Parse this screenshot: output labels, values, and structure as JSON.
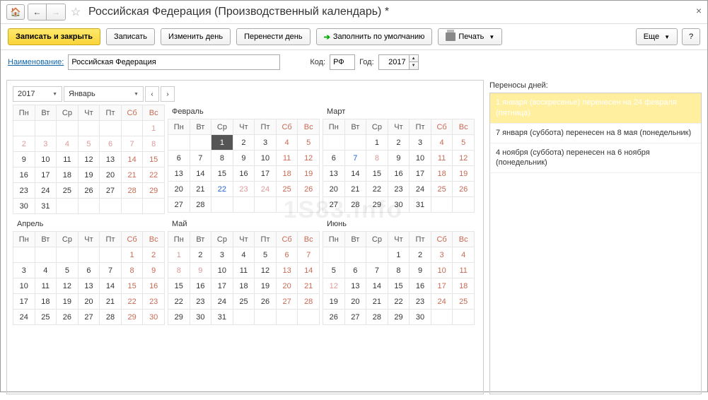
{
  "title": "Российская Федерация (Производственный календарь) *",
  "toolbar": {
    "save_close": "Записать и закрыть",
    "save": "Записать",
    "change_day": "Изменить день",
    "move_day": "Перенести день",
    "fill_default": "Заполнить по умолчанию",
    "print": "Печать",
    "more": "Еще",
    "help": "?"
  },
  "form": {
    "name_label": "Наименование:",
    "name_value": "Российская Федерация",
    "code_label": "Код:",
    "code_value": "РФ",
    "year_label": "Год:",
    "year_value": "2017"
  },
  "calendar": {
    "year": "2017",
    "month": "Январь",
    "weekdays": [
      "Пн",
      "Вт",
      "Ср",
      "Чт",
      "Пт",
      "Сб",
      "Вс"
    ],
    "months": [
      {
        "name": "",
        "start": 7,
        "days": 31,
        "holidays": [
          1,
          2,
          3,
          4,
          5,
          6,
          7,
          8
        ],
        "weekends": [
          14,
          15,
          21,
          22,
          28,
          29
        ],
        "selected": null
      },
      {
        "name": "Февраль",
        "start": 3,
        "days": 28,
        "holidays": [
          23,
          24
        ],
        "weekends": [
          4,
          5,
          11,
          12,
          18,
          19,
          25,
          26
        ],
        "preholiday": [
          22
        ],
        "selected": 1
      },
      {
        "name": "Март",
        "start": 3,
        "days": 31,
        "holidays": [
          8
        ],
        "weekends": [
          4,
          5,
          11,
          12,
          18,
          19,
          25,
          26
        ],
        "preholiday": [
          7
        ]
      },
      {
        "name": "Апрель",
        "start": 6,
        "days": 30,
        "holidays": [],
        "weekends": [
          1,
          2,
          8,
          9,
          15,
          16,
          22,
          23,
          29,
          30
        ]
      },
      {
        "name": "Май",
        "start": 1,
        "days": 31,
        "holidays": [
          1,
          8,
          9
        ],
        "weekends": [
          6,
          7,
          13,
          14,
          20,
          21,
          27,
          28
        ]
      },
      {
        "name": "Июнь",
        "start": 4,
        "days": 30,
        "holidays": [
          12
        ],
        "weekends": [
          3,
          4,
          10,
          11,
          17,
          18,
          24,
          25
        ]
      }
    ]
  },
  "side": {
    "label": "Переносы дней:",
    "items": [
      "1 января (воскресенье) перенесен на 24 февраля (пятница)",
      "7 января (суббота) перенесен на 8 мая (понедельник)",
      "4 ноября (суббота) перенесен на 6 ноября (понедельник)"
    ]
  },
  "watermark": "1S83.info"
}
